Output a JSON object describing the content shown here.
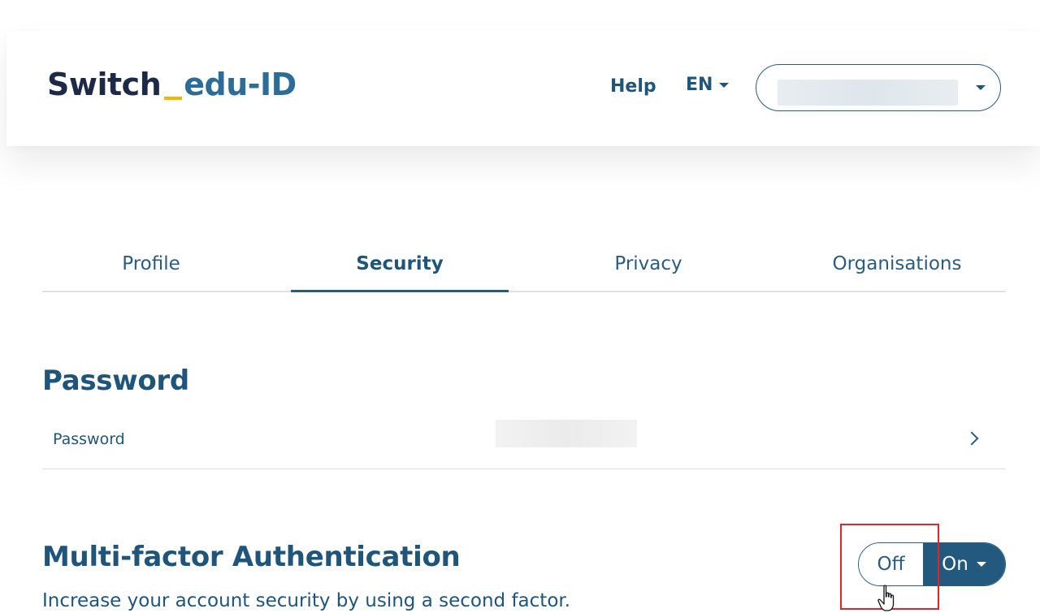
{
  "header": {
    "logo": {
      "brand": "Switch",
      "product": "edu-ID"
    },
    "help_label": "Help",
    "language": "EN",
    "account_name": ""
  },
  "tabs": [
    {
      "label": "Profile",
      "active": false
    },
    {
      "label": "Security",
      "active": true
    },
    {
      "label": "Privacy",
      "active": false
    },
    {
      "label": "Organisations",
      "active": false
    }
  ],
  "password_section": {
    "title": "Password",
    "row_label": "Password",
    "row_value": ""
  },
  "mfa_section": {
    "title": "Multi-factor Authentication",
    "description": "Increase your account security by using a second factor.",
    "toggle": {
      "off_label": "Off",
      "on_label": "On",
      "selected": "On"
    }
  },
  "colors": {
    "primary": "#2a5c80",
    "brand_dark": "#1c2a47",
    "accent": "#f5b400",
    "highlight": "#e5232a"
  }
}
